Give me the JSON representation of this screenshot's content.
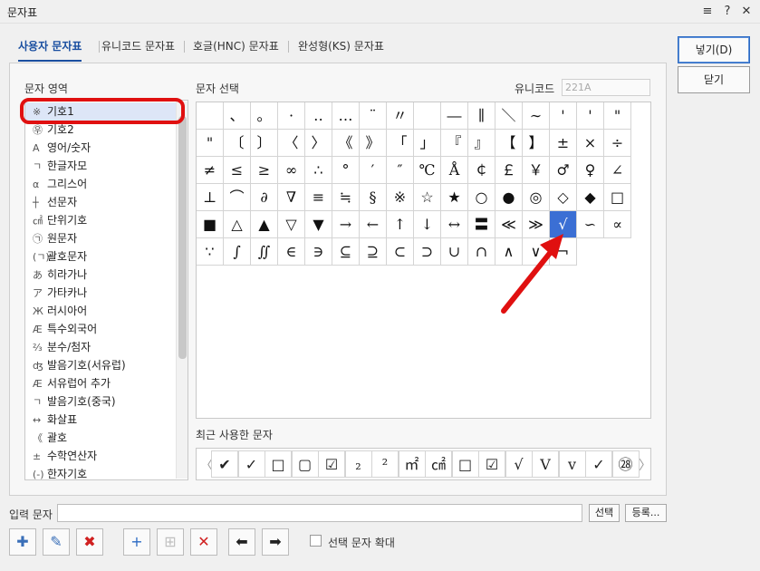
{
  "window": {
    "title": "문자표",
    "menu_icon": "≡",
    "help_icon": "?",
    "close_icon": "✕"
  },
  "tabs": [
    {
      "label": "사용자 문자표"
    },
    {
      "label": "유니코드 문자표"
    },
    {
      "label": "호글(HNC) 문자표"
    },
    {
      "label": "완성형(KS) 문자표"
    }
  ],
  "buttons": {
    "insert": "넣기(D)",
    "close": "닫기",
    "select": "선택",
    "register": "등록..."
  },
  "labels": {
    "area": "문자 영역",
    "select_char": "문자 선택",
    "unicode": "유니코드",
    "unicode_value": "221A",
    "recent": "최근 사용한 문자",
    "input": "입력 문자",
    "enlarge": "선택 문자 확대"
  },
  "area_items": [
    {
      "icon": "※",
      "label": "기호1"
    },
    {
      "icon": "㉾",
      "label": "기호2"
    },
    {
      "icon": "A",
      "label": "영어/숫자"
    },
    {
      "icon": "ㄱ",
      "label": "한글자모"
    },
    {
      "icon": "α",
      "label": "그리스어"
    },
    {
      "icon": "┼",
      "label": "선문자"
    },
    {
      "icon": "㎠",
      "label": "단위기호"
    },
    {
      "icon": "㉠",
      "label": "원문자"
    },
    {
      "icon": "(ㄱ)",
      "label": "괄호문자"
    },
    {
      "icon": "あ",
      "label": "히라가나"
    },
    {
      "icon": "ア",
      "label": "가타카나"
    },
    {
      "icon": "Ж",
      "label": "러시아어"
    },
    {
      "icon": "Æ",
      "label": "특수외국어"
    },
    {
      "icon": "⅔",
      "label": "분수/첨자"
    },
    {
      "icon": "ʤ",
      "label": "발음기호(서유럽)"
    },
    {
      "icon": "Æ",
      "label": "서유럽어 추가"
    },
    {
      "icon": "ㄱ",
      "label": "발음기호(중국)"
    },
    {
      "icon": "↔",
      "label": "화살표"
    },
    {
      "icon": "《",
      "label": "괄호"
    },
    {
      "icon": "±",
      "label": "수학연산자"
    },
    {
      "icon": "(-)",
      "label": "한자기호"
    }
  ],
  "chars": [
    [
      " ",
      "、",
      "。",
      "·",
      "‥",
      "…",
      "¨",
      "〃",
      " ",
      "―",
      "∥",
      "＼",
      "∼",
      "'",
      "'",
      "\""
    ],
    [
      "\"",
      "〔",
      "〕",
      "〈",
      "〉",
      "《",
      "》",
      "「",
      "」",
      "『",
      "』",
      "【",
      "】",
      "±",
      "×",
      "÷"
    ],
    [
      "≠",
      "≤",
      "≥",
      "∞",
      "∴",
      "°",
      "′",
      "″",
      "℃",
      "Å",
      "￠",
      "￡",
      "￥",
      "♂",
      "♀",
      "∠"
    ],
    [
      "⊥",
      "⌒",
      "∂",
      "∇",
      "≡",
      "≒",
      "§",
      "※",
      "☆",
      "★",
      "○",
      "●",
      "◎",
      "◇",
      "◆",
      "□"
    ],
    [
      "■",
      "△",
      "▲",
      "▽",
      "▼",
      "→",
      "←",
      "↑",
      "↓",
      "↔",
      "〓",
      "≪",
      "≫",
      "√",
      "∽",
      "∝"
    ],
    [
      "∵",
      "∫",
      "∬",
      "∈",
      "∋",
      "⊆",
      "⊇",
      "⊂",
      "⊃",
      "∪",
      "∩",
      "∧",
      "∨",
      "¬"
    ]
  ],
  "recent_chars": [
    "✔",
    "✓",
    "□",
    "▢",
    "☑",
    "₂",
    "²",
    "㎡",
    "㎠",
    "□",
    "☑",
    "√",
    "V",
    "v",
    "✓",
    "㉘"
  ],
  "tools": [
    {
      "icon": "✚",
      "name": "add-user-char-icon"
    },
    {
      "icon": "✎",
      "name": "edit-user-char-icon"
    },
    {
      "icon": "✖",
      "name": "delete-user-char-icon"
    },
    {
      "icon": "+",
      "name": "add-icon"
    },
    {
      "icon": "⊞",
      "name": "add-grid-icon"
    },
    {
      "icon": "✕",
      "name": "remove-icon"
    },
    {
      "icon": "⬅",
      "name": "arrow-left-icon"
    },
    {
      "icon": "➡",
      "name": "arrow-right-icon"
    }
  ],
  "colors": {
    "accent": "#1a4fa0",
    "selected_cell": "#3b6fd4",
    "highlight": "#e01010"
  }
}
